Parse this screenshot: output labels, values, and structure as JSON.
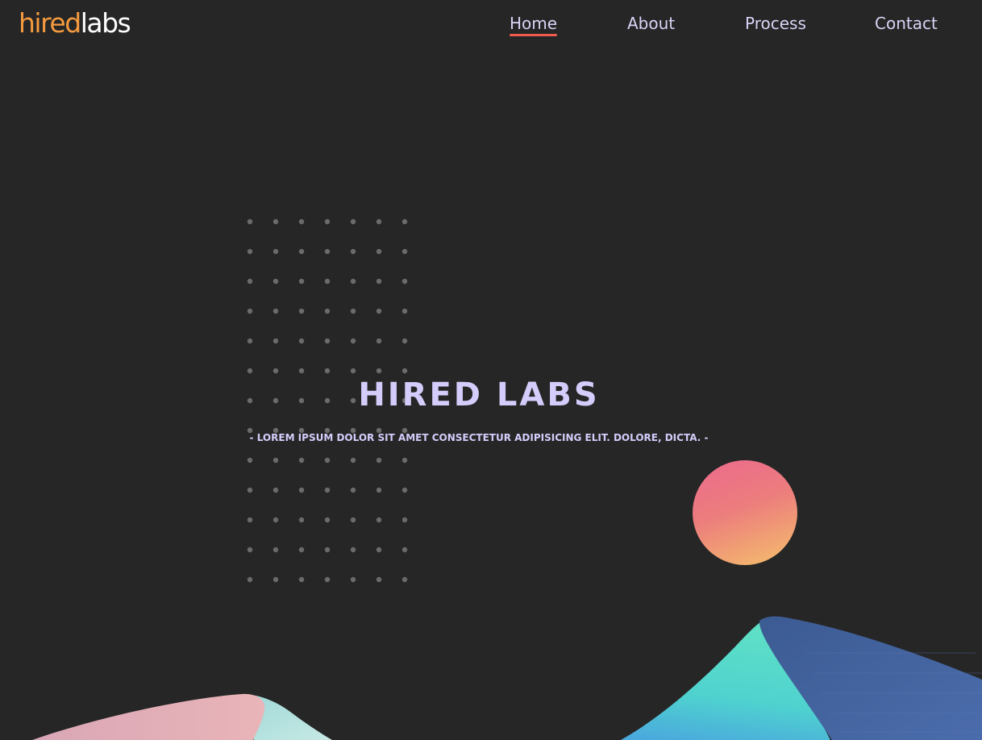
{
  "brand": {
    "part1": "hired",
    "part2": "labs",
    "color_primary": "#f59a3e",
    "color_secondary": "#ffffff"
  },
  "nav": {
    "items": [
      {
        "label": "Home",
        "active": true
      },
      {
        "label": "About",
        "active": false
      },
      {
        "label": "Process",
        "active": false
      },
      {
        "label": "Contact",
        "active": false
      }
    ],
    "active_color": "#ef5b4f",
    "text_color": "#d9d3f5"
  },
  "hero": {
    "title": "HIRED LABS",
    "subtitle": "- LOREM IPSUM DOLOR SIT AMET CONSECTETUR ADIPISICING ELIT. DOLORE, DICTA. -",
    "text_color": "#d4cdfb"
  },
  "theme": {
    "background": "#262626",
    "dot_color": "#6b6b6b"
  }
}
